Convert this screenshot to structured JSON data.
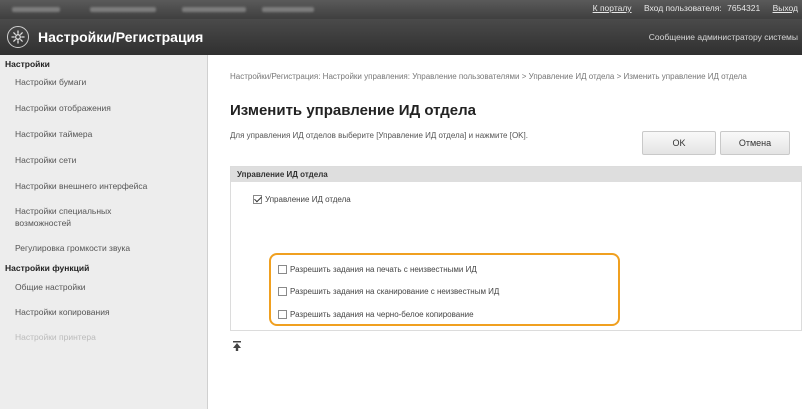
{
  "topbar": {
    "portal_link": "К порталу",
    "login_user_label": "Вход пользователя:",
    "user_id": "7654321",
    "logout": "Выход"
  },
  "header": {
    "title": "Настройки/Регистрация",
    "admin_message": "Сообщение администратору системы"
  },
  "sidebar": {
    "sections": [
      {
        "title": "Настройки",
        "items": [
          {
            "label": "Настройки бумаги",
            "lines": 1
          },
          {
            "label": "Настройки отображения",
            "lines": 1
          },
          {
            "label": "Настройки таймера",
            "lines": 1
          },
          {
            "label": "Настройки сети",
            "lines": 1
          },
          {
            "label": "Настройки внешнего интерфейса",
            "lines": 1
          },
          {
            "label": "Настройки специальных возможностей",
            "lines": 2
          },
          {
            "label": "Регулировка громкости звука",
            "lines": 1
          }
        ]
      },
      {
        "title": "Настройки функций",
        "items": [
          {
            "label": "Общие настройки",
            "lines": 1
          },
          {
            "label": "Настройки копирования",
            "lines": 1
          },
          {
            "label": "Настройки принтера",
            "lines": 1,
            "faded": true
          }
        ]
      }
    ]
  },
  "main": {
    "breadcrumb": "Настройки/Регистрация: Настройки управления: Управление пользователями > Управление ИД отдела > Изменить управление ИД отдела",
    "page_title": "Изменить управление ИД отдела",
    "description": "Для управления ИД отделов выберите [Управление ИД отдела] и нажмите [OK].",
    "ok_button": "OK",
    "cancel_button": "Отмена",
    "panel": {
      "header": "Управление ИД отдела",
      "master_checkbox": {
        "label": "Управление ИД отдела",
        "checked": true
      },
      "options": [
        {
          "label": "Разрешить задания на печать с неизвестными ИД",
          "checked": false
        },
        {
          "label": "Разрешить задания на сканирование с неизвестным ИД",
          "checked": false
        },
        {
          "label": "Разрешить задания на черно-белое копирование",
          "checked": false
        }
      ]
    },
    "highlight_color": "#f0a020"
  }
}
